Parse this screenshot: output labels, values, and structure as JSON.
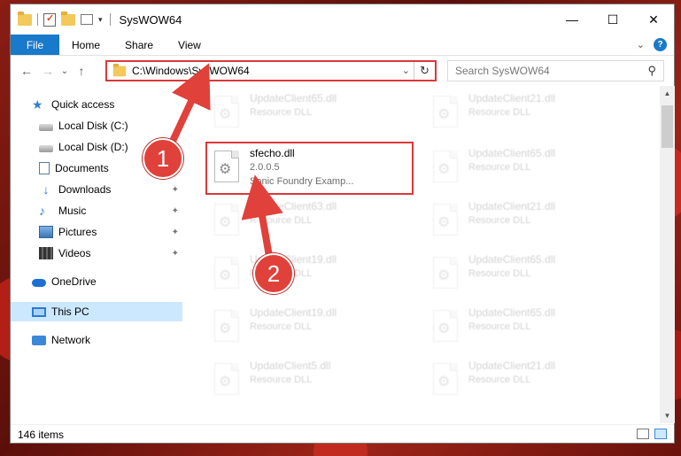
{
  "window": {
    "title": "SysWOW64",
    "controls": {
      "minimize": "—",
      "maximize": "☐",
      "close": "✕"
    }
  },
  "ribbon": {
    "tabs": [
      "File",
      "Home",
      "Share",
      "View"
    ],
    "help": "?",
    "expand": "⌄"
  },
  "nav": {
    "back": "←",
    "forward": "→",
    "recent": "⌄",
    "up": "↑"
  },
  "address": {
    "path": "C:\\Windows\\SysWOW64",
    "dropdown": "⌄",
    "refresh": "↻"
  },
  "search": {
    "placeholder": "Search SysWOW64",
    "icon": "⚲"
  },
  "sidebar": {
    "items": [
      {
        "label": "Quick access",
        "icon": "star-icon"
      },
      {
        "label": "Local Disk (C:)",
        "icon": "disk-icon"
      },
      {
        "label": "Local Disk (D:)",
        "icon": "disk-icon"
      },
      {
        "label": "Documents",
        "icon": "documents-icon"
      },
      {
        "label": "Downloads",
        "icon": "downloads-icon",
        "pinned": true
      },
      {
        "label": "Music",
        "icon": "music-icon",
        "pinned": true
      },
      {
        "label": "Pictures",
        "icon": "pictures-icon",
        "pinned": true
      },
      {
        "label": "Videos",
        "icon": "videos-icon",
        "pinned": true
      },
      {
        "label": "OneDrive",
        "icon": "onedrive-icon"
      },
      {
        "label": "This PC",
        "icon": "pc-icon",
        "selected": true
      },
      {
        "label": "Network",
        "icon": "network-icon"
      }
    ],
    "pin_glyph": "📌"
  },
  "files": {
    "highlighted": {
      "name": "sfecho.dll",
      "version": "2.0.0.5",
      "description": "Sonic Foundry Examp..."
    },
    "faded": [
      {
        "name": "UpdateClient65.dll",
        "type": "Resource DLL"
      },
      {
        "name": "UpdateClient21.dll",
        "type": "Resource DLL"
      },
      {
        "name": "UpdateClient65.dll",
        "type": "Resource DLL"
      },
      {
        "name": "UpdateClient63.dll",
        "type": "Resource DLL"
      },
      {
        "name": "UpdateClient21.dll",
        "type": "Resource DLL"
      },
      {
        "name": "UpdateClient19.dll",
        "type": "Resource DLL"
      },
      {
        "name": "UpdateClient65.dll",
        "type": "Resource DLL"
      },
      {
        "name": "UpdateClient19.dll",
        "type": "Resource DLL"
      },
      {
        "name": "UpdateClient65.dll",
        "type": "Resource DLL"
      },
      {
        "name": "UpdateClient5.dll",
        "type": "Resource DLL"
      },
      {
        "name": "UpdateClient21.dll",
        "type": "Resource DLL"
      }
    ]
  },
  "scrollbar": {
    "up": "▲",
    "down": "▼"
  },
  "status": {
    "item_count": "146 items"
  },
  "annotations": {
    "step1": "1",
    "step2": "2"
  },
  "colors": {
    "accent": "#1979ca",
    "highlight_border": "#d9393a",
    "badge": "#e0413a"
  }
}
